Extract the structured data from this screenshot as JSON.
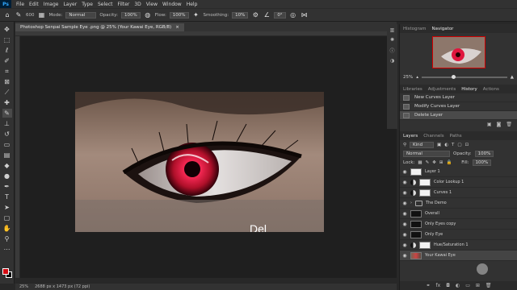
{
  "app": {
    "logo": "Ps"
  },
  "menu": [
    "File",
    "Edit",
    "Image",
    "Layer",
    "Type",
    "Select",
    "Filter",
    "3D",
    "View",
    "Window",
    "Help"
  ],
  "options_bar": {
    "brush_size": "600",
    "mode_label": "Mode:",
    "mode_value": "Normal",
    "opacity_label": "Opacity:",
    "opacity_value": "100%",
    "flow_label": "Flow:",
    "flow_value": "100%",
    "smoothing_label": "Smoothing:",
    "smoothing_value": "10%",
    "angle_value": "0°"
  },
  "document": {
    "tab_title": "Photoshop Senpai Sample Eye .png @ 25% (Your Kawai Eye, RGB/8)",
    "tab_close": "×",
    "caption": "Del"
  },
  "status_bar": {
    "zoom": "25%",
    "doc_info": "2688 px x 1473 px (72 ppi)"
  },
  "navigator": {
    "tabs": [
      "Histogram",
      "Navigator"
    ],
    "active_tab": "Navigator",
    "zoom": "25%"
  },
  "history": {
    "tabs": [
      "Libraries",
      "Adjustments",
      "History",
      "Actions"
    ],
    "active_tab": "History",
    "states": [
      "New Curves Layer",
      "Modify Curves Layer",
      "Delete Layer"
    ],
    "selected_index": 2
  },
  "layers": {
    "tabs": [
      "Layers",
      "Channels",
      "Paths"
    ],
    "active_tab": "Layers",
    "kind_filter": "Kind",
    "blend_mode": "Normal",
    "opacity_label": "Opacity:",
    "opacity_value": "100%",
    "lock_label": "Lock:",
    "fill_label": "Fill:",
    "fill_value": "100%",
    "rows": [
      {
        "name": "Layer 1",
        "thumb": "white"
      },
      {
        "name": "Color Lookup 1",
        "thumb": "white"
      },
      {
        "name": "Curves 1",
        "thumb": "white"
      },
      {
        "name": "The Demo",
        "thumb": "folder"
      },
      {
        "name": "Overall",
        "thumb": "dark"
      },
      {
        "name": "Only Eyes copy",
        "thumb": "dark"
      },
      {
        "name": "Only Eye",
        "thumb": "dark"
      },
      {
        "name": "Hue/Saturation 1",
        "thumb": "white"
      },
      {
        "name": "Your Kawai Eye",
        "thumb": "eyeimg"
      }
    ],
    "selected_index": 8
  },
  "colors": {
    "foreground": "#d40b12",
    "background": "#000000",
    "accent": "#31a8ff"
  }
}
